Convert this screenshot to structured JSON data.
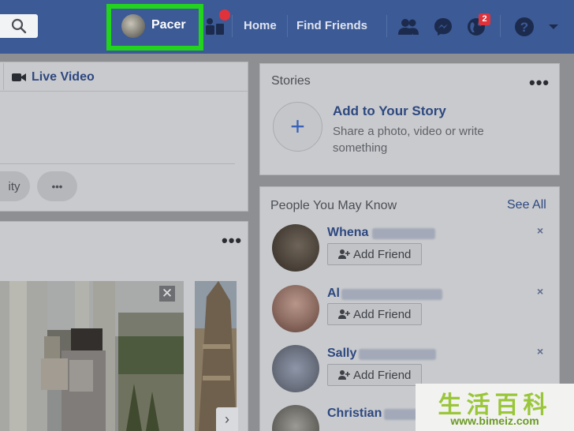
{
  "header": {
    "profile_name": "Pacer",
    "nav": {
      "home": "Home",
      "find_friends": "Find Friends"
    },
    "notifications_count": "2",
    "icons": [
      "search-icon",
      "create-icon",
      "friend-requests-icon",
      "messenger-icon",
      "notifications-globe-icon",
      "help-icon",
      "chevron-down-icon"
    ],
    "colors": {
      "bar": "#3c5a96",
      "highlight": "#22d51c",
      "badge": "#e0323b"
    }
  },
  "composer": {
    "live_video_label": "Live Video",
    "pill_partial": "ity",
    "more_label": "•••"
  },
  "feed_post": {
    "more_label": "•••",
    "close_label": "✕",
    "next_label": "›"
  },
  "stories": {
    "title": "Stories",
    "more_label": "•••",
    "add_title": "Add to Your Story",
    "add_subtitle": "Share a photo, video or write something",
    "plus": "+"
  },
  "pymk": {
    "title": "People You May Know",
    "see_all": "See All",
    "people": [
      {
        "name": "Whena",
        "button": "Add Friend",
        "dismiss": "×"
      },
      {
        "name": "Al",
        "button": "Add Friend",
        "dismiss": "×"
      },
      {
        "name": "Sally",
        "button": "Add Friend",
        "dismiss": "×"
      },
      {
        "name": "Christian"
      }
    ]
  },
  "watermark": {
    "title": "生活百科",
    "url": "www.bimeiz.com"
  }
}
